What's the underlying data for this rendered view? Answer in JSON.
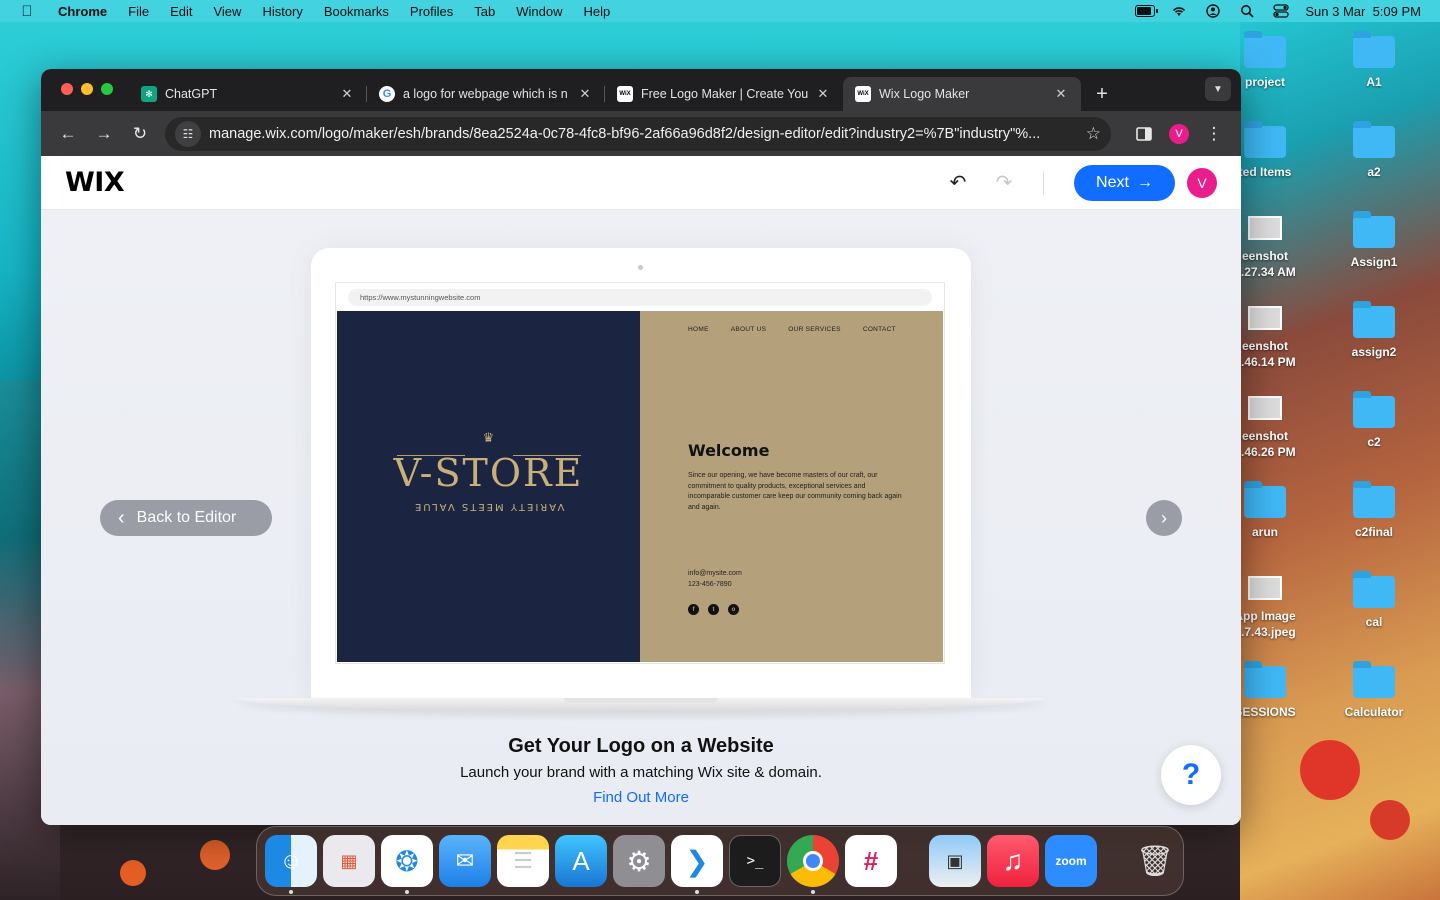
{
  "menubar": {
    "app_name": "Chrome",
    "items": [
      "File",
      "Edit",
      "View",
      "History",
      "Bookmarks",
      "Profiles",
      "Tab",
      "Window",
      "Help"
    ],
    "datetime": "Sun 3 Mar  5:09 PM",
    "battery_level": 0.85
  },
  "desktop": {
    "icons": [
      {
        "label": "project"
      },
      {
        "label": "A1"
      },
      {
        "label": "ted Items"
      },
      {
        "label": "a2"
      },
      {
        "label": "eenshot\n...27.34 AM"
      },
      {
        "label": "Assign1"
      },
      {
        "label": "eenshot\n...46.14 PM"
      },
      {
        "label": "assign2"
      },
      {
        "label": "eenshot\n...46.26 PM"
      },
      {
        "label": "c2"
      },
      {
        "label": "arun"
      },
      {
        "label": "c2final"
      },
      {
        "label": "App Image\n...7.43.jpeg"
      },
      {
        "label": "cal"
      },
      {
        "label": "SESSIONS"
      },
      {
        "label": "Calculator"
      }
    ]
  },
  "browser": {
    "tabs": [
      {
        "title": "ChatGPT",
        "favicon": "chatgpt-icon",
        "active": false
      },
      {
        "title": "a logo for webpage which is n",
        "favicon": "google-icon",
        "active": false
      },
      {
        "title": "Free Logo Maker | Create You",
        "favicon": "wix-icon",
        "active": false
      },
      {
        "title": "Wix Logo Maker",
        "favicon": "wix-icon",
        "active": true
      }
    ],
    "favicon_text": "WiX",
    "url": "manage.wix.com/logo/maker/esh/brands/8ea2524a-0c78-4fc8-bf96-2af66a96d8f2/design-editor/edit?industry2=%7B\"industry\"%...",
    "profile_initial": "V"
  },
  "wix": {
    "logo": "WIX",
    "next_label": "Next",
    "avatar_initial": "V",
    "back_label": "Back to Editor",
    "help_label": "?",
    "accent_color": "#116dff",
    "mockup": {
      "url": "https://www.mystunningwebsite.com",
      "brand_name": "V-STORE",
      "brand_tagline": "VARIETY MEETS VALUE",
      "nav": [
        "HOME",
        "ABOUT US",
        "OUR SERVICES",
        "CONTACT"
      ],
      "welcome_title": "Welcome",
      "welcome_text": "Since our opening, we have become masters of our craft, our commitment to quality products, exceptional services and incomparable customer care keep our community coming back again and again.",
      "email": "info@mysite.com",
      "phone": "123-456-7890",
      "left_color": "#1b2440",
      "right_color": "#b4a07a",
      "logo_color": "#c9b07a"
    },
    "promo": {
      "title": "Get Your Logo on a Website",
      "subtitle": "Launch your brand with a matching Wix site & domain.",
      "link": "Find Out More"
    }
  },
  "dock": {
    "apps": [
      "finder-icon",
      "launchpad-icon",
      "safari-icon",
      "mail-icon",
      "notes-icon",
      "app-store-icon",
      "system-settings-icon",
      "vscode-icon",
      "terminal-icon",
      "chrome-icon",
      "slack-icon",
      "preview-icon",
      "music-icon",
      "zoom-icon",
      "trash-icon"
    ],
    "zoom_label": "zoom"
  }
}
